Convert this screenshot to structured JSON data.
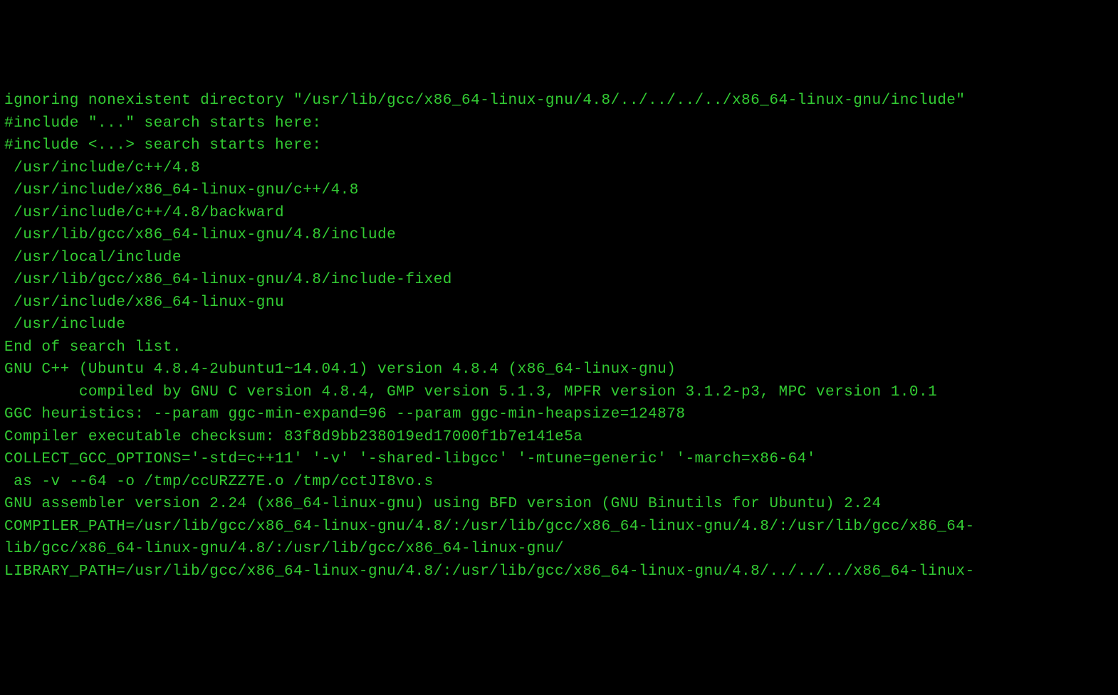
{
  "terminal": {
    "lines": [
      "ignoring nonexistent directory \"/usr/lib/gcc/x86_64-linux-gnu/4.8/../../../../x86_64-linux-gnu/include\"",
      "#include \"...\" search starts here:",
      "#include <...> search starts here:",
      " /usr/include/c++/4.8",
      " /usr/include/x86_64-linux-gnu/c++/4.8",
      " /usr/include/c++/4.8/backward",
      " /usr/lib/gcc/x86_64-linux-gnu/4.8/include",
      " /usr/local/include",
      " /usr/lib/gcc/x86_64-linux-gnu/4.8/include-fixed",
      " /usr/include/x86_64-linux-gnu",
      " /usr/include",
      "End of search list.",
      "GNU C++ (Ubuntu 4.8.4-2ubuntu1~14.04.1) version 4.8.4 (x86_64-linux-gnu)",
      "        compiled by GNU C version 4.8.4, GMP version 5.1.3, MPFR version 3.1.2-p3, MPC version 1.0.1",
      "GGC heuristics: --param ggc-min-expand=96 --param ggc-min-heapsize=124878",
      "Compiler executable checksum: 83f8d9bb238019ed17000f1b7e141e5a",
      "COLLECT_GCC_OPTIONS='-std=c++11' '-v' '-shared-libgcc' '-mtune=generic' '-march=x86-64'",
      " as -v --64 -o /tmp/ccURZZ7E.o /tmp/cctJI8vo.s",
      "GNU assembler version 2.24 (x86_64-linux-gnu) using BFD version (GNU Binutils for Ubuntu) 2.24",
      "COMPILER_PATH=/usr/lib/gcc/x86_64-linux-gnu/4.8/:/usr/lib/gcc/x86_64-linux-gnu/4.8/:/usr/lib/gcc/x86_64-",
      "lib/gcc/x86_64-linux-gnu/4.8/:/usr/lib/gcc/x86_64-linux-gnu/",
      "LIBRARY_PATH=/usr/lib/gcc/x86_64-linux-gnu/4.8/:/usr/lib/gcc/x86_64-linux-gnu/4.8/../../../x86_64-linux-"
    ]
  }
}
